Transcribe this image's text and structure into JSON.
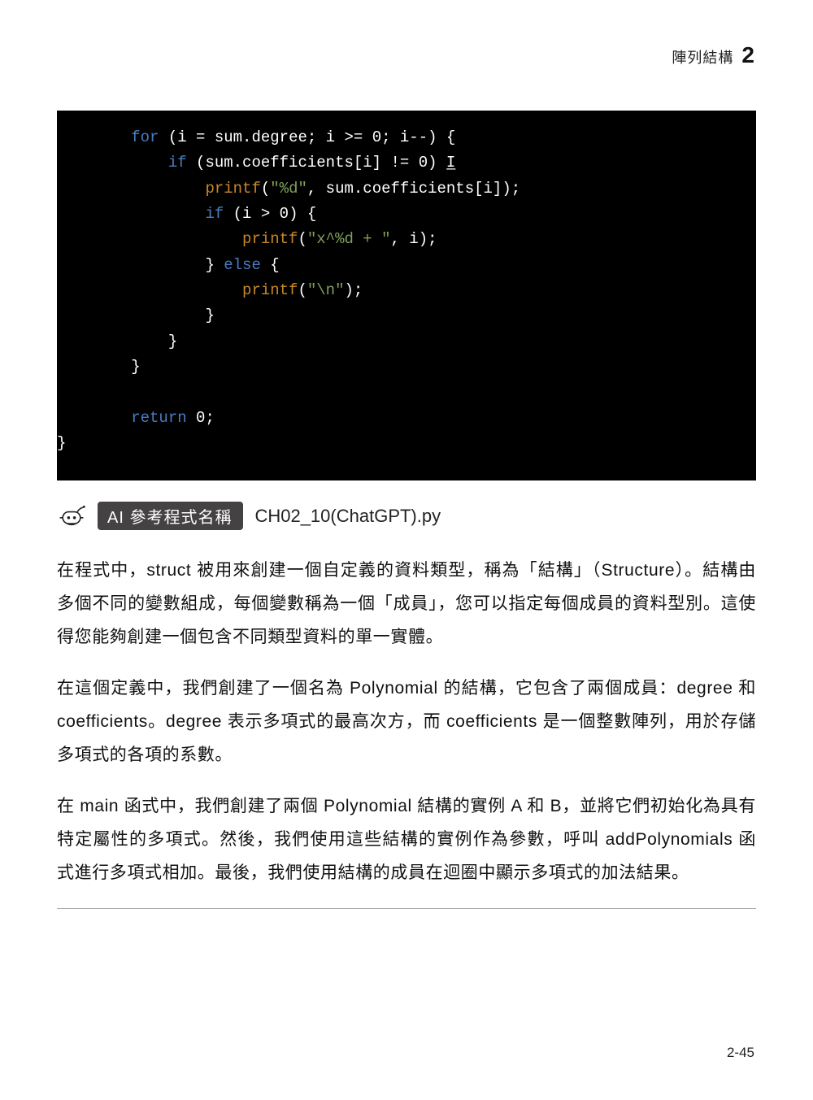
{
  "header": {
    "chapter_title": "陣列結構",
    "chapter_number": "2"
  },
  "code": {
    "tokens": [
      {
        "indent": 2,
        "parts": [
          {
            "t": "kw",
            "v": "for"
          },
          {
            "t": "punct",
            "v": " (i = sum.degree; i >= "
          },
          {
            "t": "num",
            "v": "0"
          },
          {
            "t": "punct",
            "v": "; i--) {"
          }
        ]
      },
      {
        "indent": 3,
        "parts": [
          {
            "t": "kw",
            "v": "if"
          },
          {
            "t": "punct",
            "v": " (sum.coefficients[i] != "
          },
          {
            "t": "num",
            "v": "0"
          },
          {
            "t": "punct",
            "v": ") "
          },
          {
            "t": "cursor",
            "v": "I̲"
          }
        ]
      },
      {
        "indent": 4,
        "parts": [
          {
            "t": "fn",
            "v": "printf"
          },
          {
            "t": "punct",
            "v": "("
          },
          {
            "t": "str",
            "v": "\"%d\""
          },
          {
            "t": "punct",
            "v": ", sum.coefficients[i]);"
          }
        ]
      },
      {
        "indent": 4,
        "parts": [
          {
            "t": "kw",
            "v": "if"
          },
          {
            "t": "punct",
            "v": " (i > "
          },
          {
            "t": "num",
            "v": "0"
          },
          {
            "t": "punct",
            "v": ") {"
          }
        ]
      },
      {
        "indent": 5,
        "parts": [
          {
            "t": "fn",
            "v": "printf"
          },
          {
            "t": "punct",
            "v": "("
          },
          {
            "t": "str",
            "v": "\"x^%d + \""
          },
          {
            "t": "punct",
            "v": ", i);"
          }
        ]
      },
      {
        "indent": 4,
        "parts": [
          {
            "t": "punct",
            "v": "} "
          },
          {
            "t": "kw",
            "v": "else"
          },
          {
            "t": "punct",
            "v": " {"
          }
        ]
      },
      {
        "indent": 5,
        "parts": [
          {
            "t": "fn",
            "v": "printf"
          },
          {
            "t": "punct",
            "v": "("
          },
          {
            "t": "str",
            "v": "\"\\n\""
          },
          {
            "t": "punct",
            "v": ");"
          }
        ]
      },
      {
        "indent": 4,
        "parts": [
          {
            "t": "punct",
            "v": "}"
          }
        ]
      },
      {
        "indent": 3,
        "parts": [
          {
            "t": "punct",
            "v": "}"
          }
        ]
      },
      {
        "indent": 2,
        "parts": [
          {
            "t": "punct",
            "v": "}"
          }
        ]
      },
      {
        "indent": 0,
        "parts": [
          {
            "t": "punct",
            "v": ""
          }
        ]
      },
      {
        "indent": 2,
        "parts": [
          {
            "t": "kw",
            "v": "return"
          },
          {
            "t": "punct",
            "v": " "
          },
          {
            "t": "num",
            "v": "0"
          },
          {
            "t": "punct",
            "v": ";"
          }
        ]
      },
      {
        "indent": 0,
        "parts": [
          {
            "t": "punct",
            "v": "}"
          }
        ]
      }
    ]
  },
  "ai_ref": {
    "label": "AI 參考程式名稱",
    "filename": "CH02_10(ChatGPT).py"
  },
  "paragraphs": [
    "在程式中，struct 被用來創建一個自定義的資料類型，稱為「結構」（Structure）。結構由多個不同的變數組成，每個變數稱為一個「成員」，您可以指定每個成員的資料型別。這使得您能夠創建一個包含不同類型資料的單一實體。",
    "在這個定義中，我們創建了一個名為 Polynomial 的結構，它包含了兩個成員：degree 和 coefficients。degree 表示多項式的最高次方，而 coefficients 是一個整數陣列，用於存儲多項式的各項的系數。",
    "在 main 函式中，我們創建了兩個 Polynomial 結構的實例 A 和 B，並將它們初始化為具有特定屬性的多項式。然後，我們使用這些結構的實例作為參數，呼叫 addPolynomials 函式進行多項式相加。最後，我們使用結構的成員在迴圈中顯示多項式的加法結果。"
  ],
  "page_number": "2-45",
  "icons": {
    "robot": "robot-icon"
  }
}
